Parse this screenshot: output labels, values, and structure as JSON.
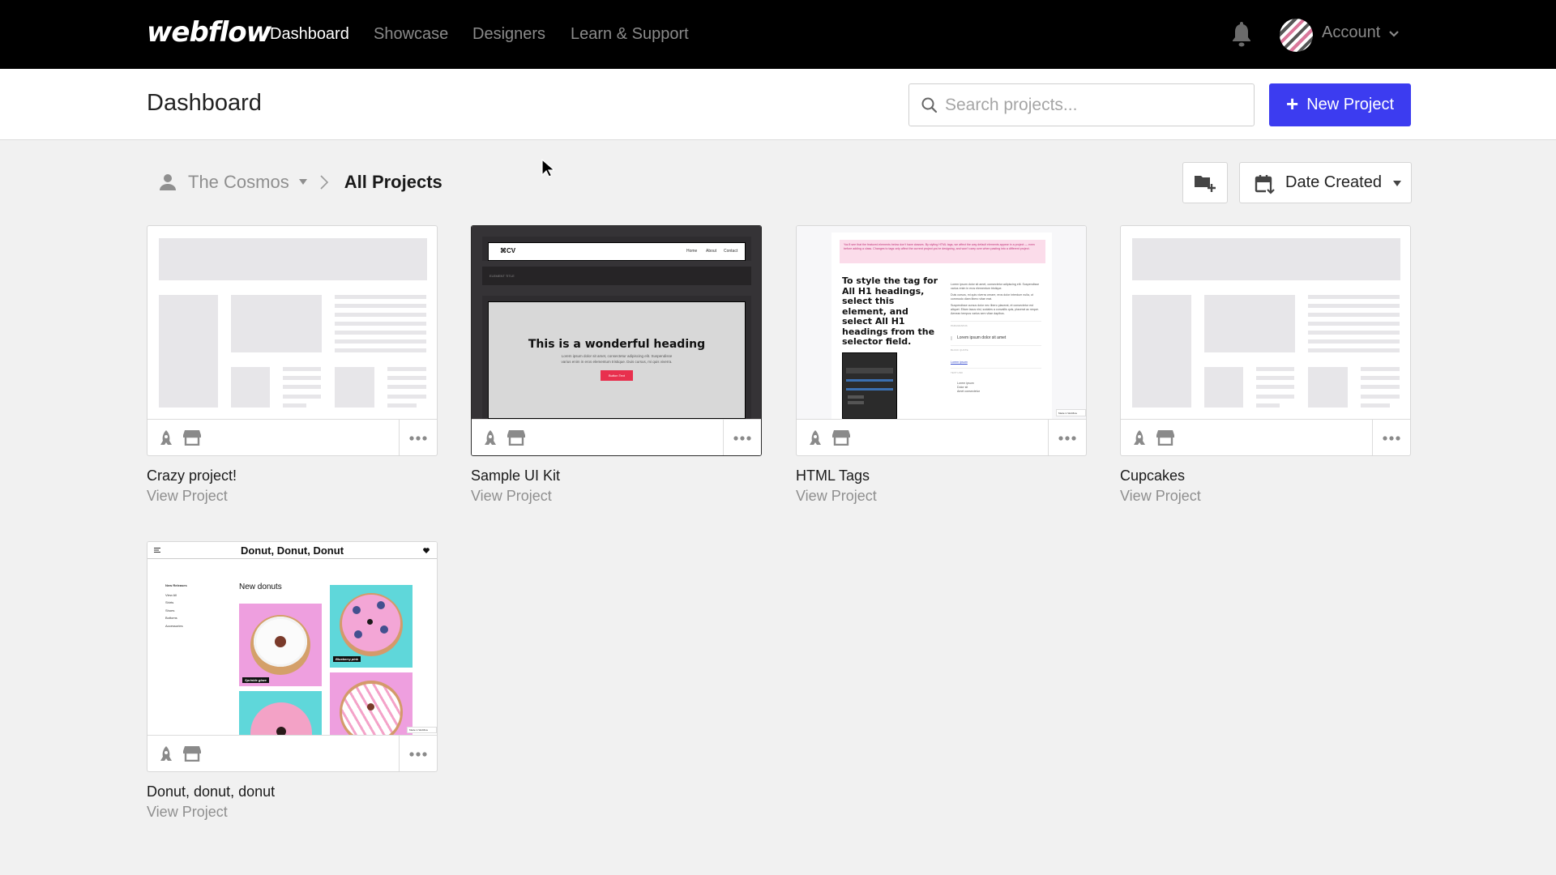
{
  "navbar": {
    "logo": "webflow",
    "links": [
      {
        "label": "Dashboard",
        "active": true
      },
      {
        "label": "Showcase",
        "active": false
      },
      {
        "label": "Designers",
        "active": false
      },
      {
        "label": "Learn & Support",
        "active": false
      }
    ],
    "notifications_icon": "bell-icon",
    "account_label": "Account"
  },
  "header": {
    "title": "Dashboard",
    "search_placeholder": "Search projects...",
    "search_value": "",
    "new_project_label": "New Project",
    "accent_color": "#3c3cf0"
  },
  "toolbar": {
    "breadcrumb": {
      "workspace": "The Cosmos",
      "current": "All Projects"
    },
    "new_folder_icon": "folder-plus-icon",
    "sort_label": "Date Created"
  },
  "projects": [
    {
      "title": "Crazy project!",
      "link": "View Project",
      "thumbnail": "wireframe-placeholder"
    },
    {
      "title": "Sample UI Kit",
      "link": "View Project",
      "thumbnail": "ui-kit",
      "preview": {
        "brand": "⌘CV",
        "nav": [
          "Home",
          "About",
          "Contact"
        ],
        "section_label": "ELEMENT TITLE",
        "heading": "This is a wonderful heading",
        "body": "Lorem ipsum dolor sit amet, consectetur adipiscing elit. Suspendisse varius enim in eros elementum tristique. Duis cursus, mi quis viverra.",
        "button": "Button Text"
      }
    },
    {
      "title": "HTML Tags",
      "link": "View Project",
      "thumbnail": "html-tags",
      "preview": {
        "notice": "You'll see that the featured elements below don't have classes. By styling HTML tags, we affect the way default elements appear in a project — even before adding a class. Changes to tags only affect the current project you're designing, and won't carry over when pasting into a different project.",
        "heading": "To style the tag for All H1 headings, select this element, and select All H1 headings from the selector field.",
        "para1": "Lorem ipsum dolor sit amet, consectetur adipiscing elit. Suspendisse varius enim in eros elementum tristique.",
        "para2": "Duis cursus, mi quis viverra ornare, eros dolor interdum nulla, ut commodo diam libero vitae erat.",
        "para3": "Suspendisse cursus dolor nec libero placerat, et consectetur est aliquet. Etiam lacus nisl, sodales a convallis quis, placerat ac neque. Aenean tempus varius sem vitae dapibus.",
        "label_paragraphs": "PARAGRAPHS",
        "quote": "Lorem ipsum dolor sit amet",
        "label_quote": "BLOCK QUOTE",
        "link": "Lorem ipsum",
        "label_link": "TEXT LINK",
        "list": [
          "Lorem ipsum",
          "Dolor sit",
          "Amet consectetur"
        ],
        "label_list": "ORDERED LIST & LIST ITEMS",
        "badge": "Made in Webflow"
      }
    },
    {
      "title": "Cupcakes",
      "link": "View Project",
      "thumbnail": "wireframe-placeholder"
    },
    {
      "title": "Donut, donut, donut",
      "link": "View Project",
      "thumbnail": "donut-shop",
      "preview": {
        "site_title": "Donut, Donut, Donut",
        "menu_heading": "New Releases",
        "menu": [
          "View All",
          "Shirts",
          "Shoes",
          "Bottoms",
          "Accessories"
        ],
        "section": "New donuts",
        "captions": [
          "Sprinkle glaze",
          "Blueberry pink"
        ],
        "badge": "Made in Webflow"
      }
    }
  ]
}
